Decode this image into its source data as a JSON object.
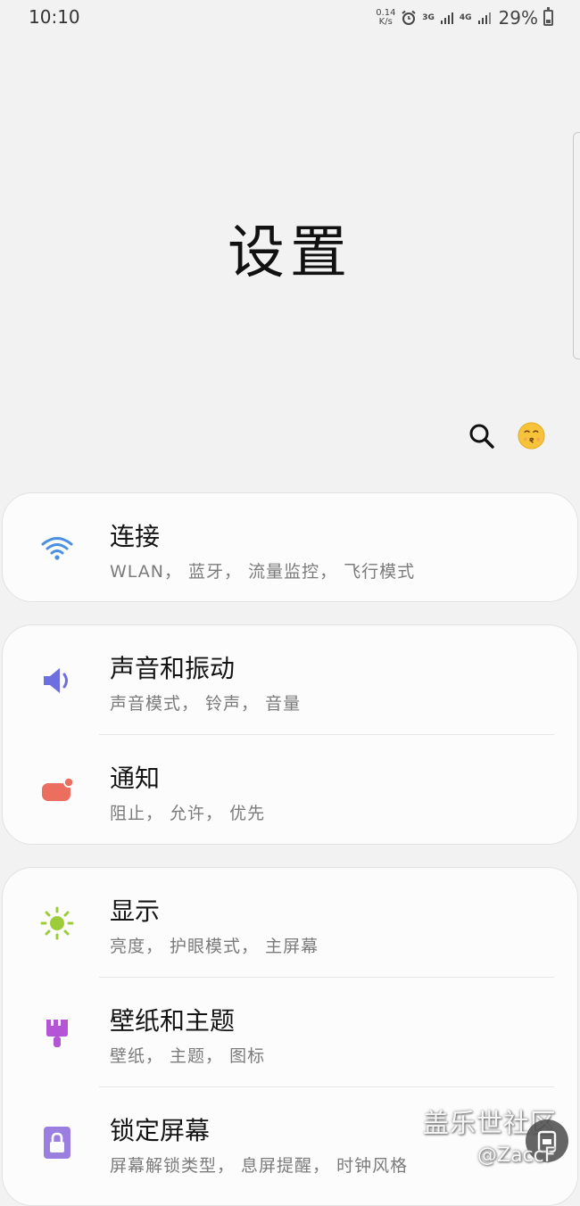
{
  "status_bar": {
    "time": "10:10",
    "net_speed_value": "0.14",
    "net_speed_unit": "K/s",
    "net1": "3G",
    "net2": "4G",
    "battery": "29%"
  },
  "header": {
    "title": "设置"
  },
  "icons": {
    "search": "search-icon",
    "avatar": "emoji-avatar"
  },
  "settings": {
    "connections": {
      "title": "连接",
      "subtitle": "WLAN， 蓝牙， 流量监控， 飞行模式",
      "icon": "wifi-icon",
      "color": "#4a90e2"
    },
    "sound": {
      "title": "声音和振动",
      "subtitle": "声音模式， 铃声， 音量",
      "icon": "speaker-icon",
      "color": "#6d6ee0"
    },
    "notifications": {
      "title": "通知",
      "subtitle": "阻止， 允许， 优先",
      "icon": "notification-icon",
      "color": "#ec6e5e"
    },
    "display": {
      "title": "显示",
      "subtitle": "亮度， 护眼模式， 主屏幕",
      "icon": "sun-icon",
      "color": "#9ccc3a"
    },
    "wallpaper": {
      "title": "壁纸和主题",
      "subtitle": "壁纸， 主题， 图标",
      "icon": "paintbrush-icon",
      "color": "#b455d6"
    },
    "lockscreen": {
      "title": "锁定屏幕",
      "subtitle": "屏幕解锁类型， 息屏提醒， 时钟风格",
      "icon": "lock-icon",
      "color": "#9a7ee0"
    }
  },
  "watermark": {
    "site": "盖乐世社区",
    "user": "@ZaccF"
  }
}
